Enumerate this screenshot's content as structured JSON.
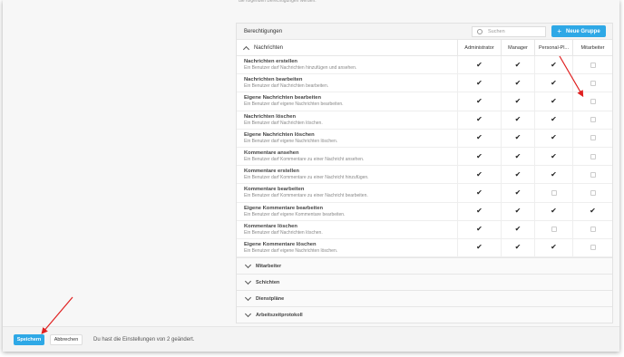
{
  "top_text": "die folgenden Berechtigungen werden.",
  "panel": {
    "title": "Berechtigungen",
    "search_placeholder": "Suchen",
    "new_group_label": "Neue Gruppe",
    "group_label": "Nachrichten",
    "columns": [
      "Administrator",
      "Manager",
      "Personal-Pl...",
      "Mitarbeiter"
    ]
  },
  "rows": [
    {
      "title": "Nachrichten erstellen",
      "desc": "Ein Benutzer darf Nachrichten hinzufügen und ansehen.",
      "checks": [
        true,
        true,
        true,
        false
      ]
    },
    {
      "title": "Nachrichten bearbeiten",
      "desc": "Ein Benutzer darf Nachrichten bearbeiten.",
      "checks": [
        true,
        true,
        true,
        false
      ]
    },
    {
      "title": "Eigene Nachrichten bearbeiten",
      "desc": "Ein Benutzer darf eigene Nachrichten bearbeiten.",
      "checks": [
        true,
        true,
        true,
        false
      ]
    },
    {
      "title": "Nachrichten löschen",
      "desc": "Ein Benutzer darf Nachrichten löschen.",
      "checks": [
        true,
        true,
        true,
        false
      ]
    },
    {
      "title": "Eigene Nachrichten löschen",
      "desc": "Ein Benutzer darf eigene Nachrichten löschen.",
      "checks": [
        true,
        true,
        true,
        false
      ]
    },
    {
      "title": "Kommentare ansehen",
      "desc": "Ein Benutzer darf Kommentare zu einer Nachricht ansehen.",
      "checks": [
        true,
        true,
        true,
        false
      ]
    },
    {
      "title": "Kommentare erstellen",
      "desc": "Ein Benutzer darf Kommentare zu einer Nachricht hinzufügen.",
      "checks": [
        true,
        true,
        true,
        false
      ]
    },
    {
      "title": "Kommentare bearbeiten",
      "desc": "Ein Benutzer darf Kommentare zu einer Nachricht bearbeiten.",
      "checks": [
        true,
        true,
        false,
        false
      ]
    },
    {
      "title": "Eigene Kommentare bearbeiten",
      "desc": "Ein Benutzer darf eigene Kommentare bearbeiten.",
      "checks": [
        true,
        true,
        true,
        true
      ]
    },
    {
      "title": "Kommentare löschen",
      "desc": "Ein Benutzer darf Nachrichten löschen.",
      "checks": [
        true,
        true,
        false,
        false
      ]
    },
    {
      "title": "Eigene Kommentare löschen",
      "desc": "Ein Benutzer darf eigene Nachrichten löschen.",
      "checks": [
        true,
        true,
        true,
        false
      ]
    }
  ],
  "sections": [
    "Mitarbeiter",
    "Schichten",
    "Dienstpläne",
    "Arbeitszeitprotokoll"
  ],
  "footer": {
    "save_label": "Speichern",
    "cancel_label": "Abbrechen",
    "status_text": "Du hast die Einstellungen von 2 geändert."
  },
  "colors": {
    "accent": "#2ea8e6",
    "annotation_arrow": "#e02020"
  }
}
